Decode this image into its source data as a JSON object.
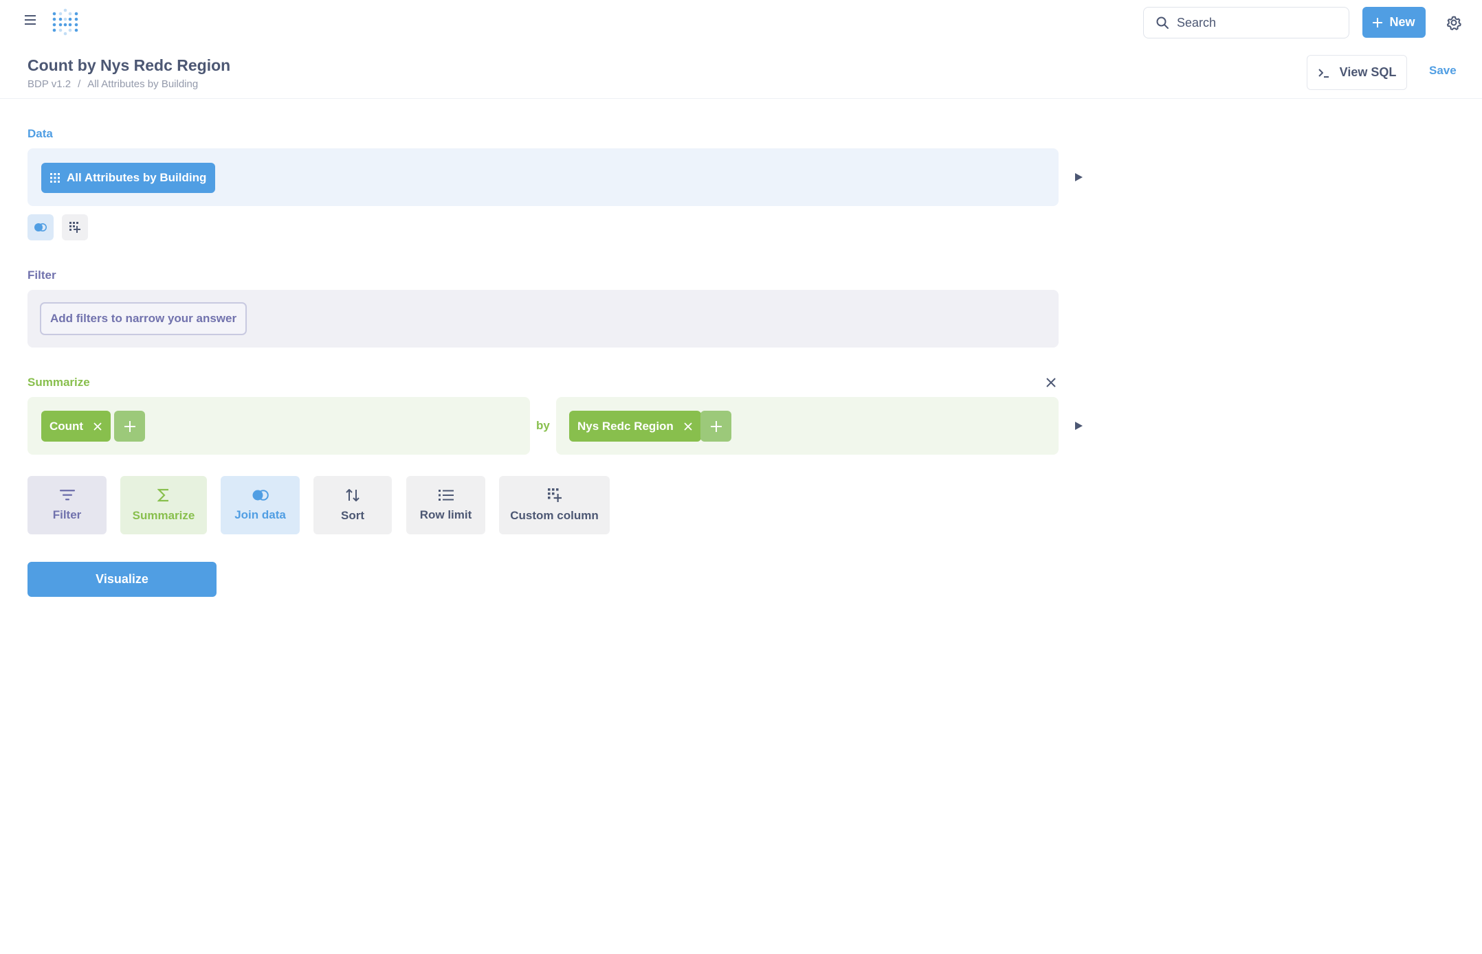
{
  "nav": {
    "search_placeholder": "Search",
    "new_label": "New"
  },
  "header": {
    "title": "Count by Nys Redc Region",
    "breadcrumb": [
      "BDP v1.2",
      "/",
      "All Attributes by Building"
    ],
    "view_sql_label": "View SQL",
    "save_label": "Save"
  },
  "data": {
    "label": "Data",
    "table": "All Attributes by Building"
  },
  "filter": {
    "label": "Filter",
    "add_label": "Add filters to narrow your answer"
  },
  "summarize": {
    "label": "Summarize",
    "metric": "Count",
    "by_label": "by",
    "group": "Nys Redc Region"
  },
  "steps": {
    "filter": "Filter",
    "summarize": "Summarize",
    "join": "Join data",
    "sort": "Sort",
    "row_limit": "Row limit",
    "custom_column": "Custom column"
  },
  "visualize_label": "Visualize",
  "colors": {
    "brand": "#509ee3",
    "filter": "#7172ad",
    "summarize": "#88bf4d",
    "text": "#4c5773"
  }
}
